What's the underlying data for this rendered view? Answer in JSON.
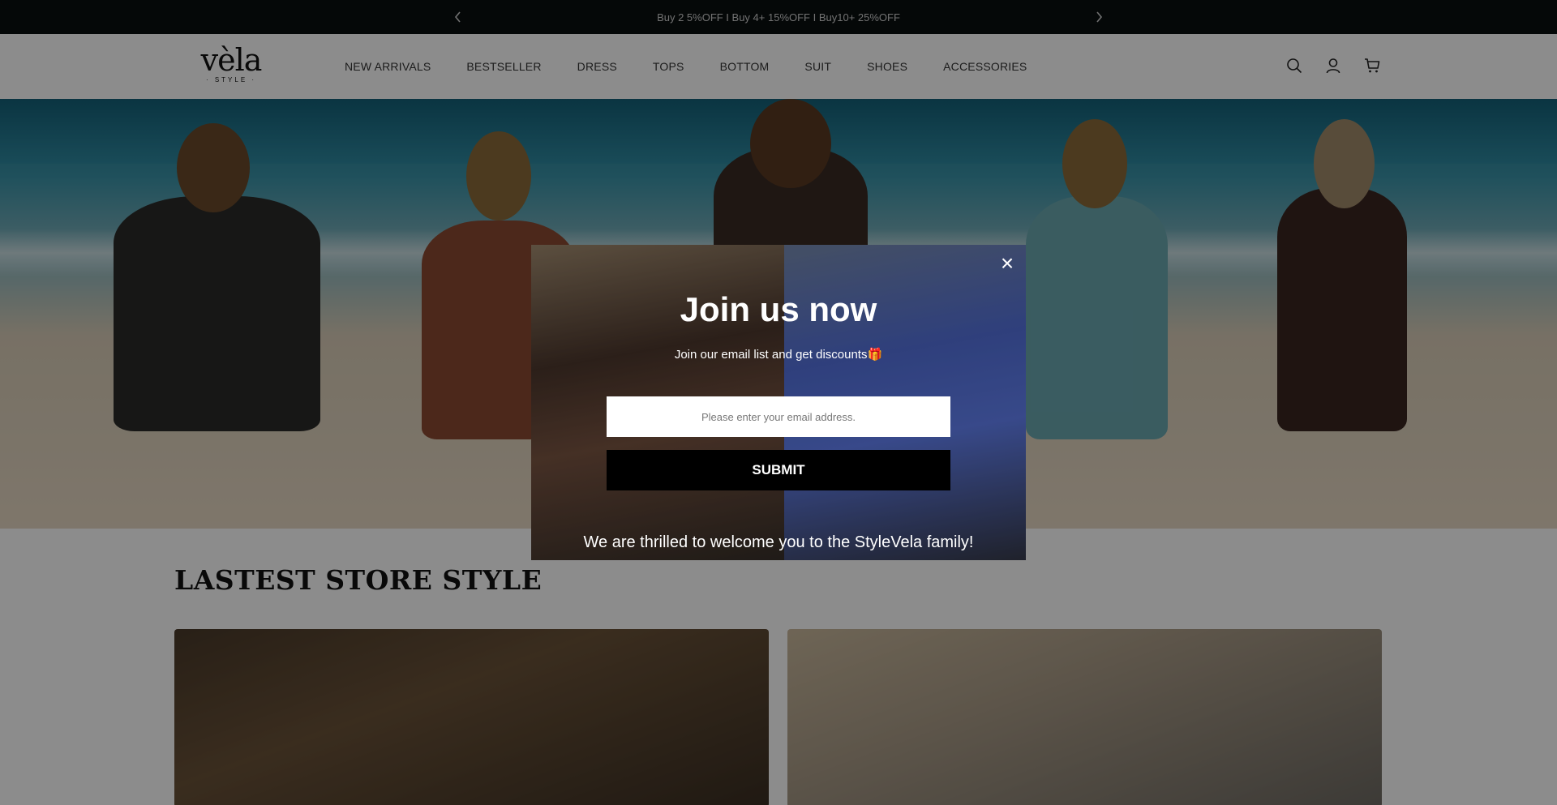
{
  "announcement": {
    "text": "Buy 2 5%OFF I Buy 4+ 15%OFF I Buy10+ 25%OFF",
    "prev_icon": "chevron-left-icon",
    "next_icon": "chevron-right-icon"
  },
  "header": {
    "logo_word": "vèla",
    "logo_sub": "· STYLE ·",
    "nav": [
      {
        "label": "NEW ARRIVALS"
      },
      {
        "label": "BESTSELLER"
      },
      {
        "label": "DRESS"
      },
      {
        "label": "TOPS"
      },
      {
        "label": "BOTTOM"
      },
      {
        "label": "SUIT"
      },
      {
        "label": "SHOES"
      },
      {
        "label": "ACCESSORIES"
      }
    ],
    "icons": [
      "search-icon",
      "account-icon",
      "cart-icon"
    ]
  },
  "section": {
    "title": "LASTEST STORE STYLE"
  },
  "popup": {
    "close_label": "×",
    "title": "Join us now",
    "subtitle": "Join our email list and get discounts🎁",
    "email_placeholder": "Please enter your email address.",
    "submit_label": "SUBMIT",
    "welcome": "We are thrilled to welcome you to the StyleVela family!"
  },
  "colors": {
    "announcement_bg": "#0a0f10",
    "submit_bg": "#000000",
    "overlay": "rgba(0,0,0,0.45)"
  }
}
